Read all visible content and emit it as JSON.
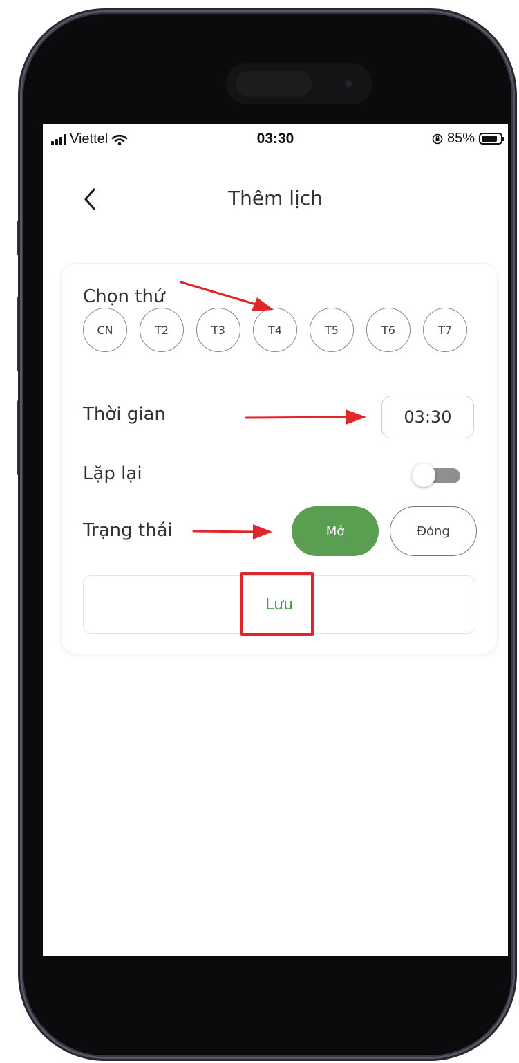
{
  "status_bar": {
    "carrier": "Viettel",
    "time": "03:30",
    "battery": "85%",
    "battery_level": 0.85
  },
  "nav": {
    "title": "Thêm lịch"
  },
  "form": {
    "day_label": "Chọn thứ",
    "days": [
      "CN",
      "T2",
      "T3",
      "T4",
      "T5",
      "T6",
      "T7"
    ],
    "time_label": "Thời gian",
    "time_value": "03:30",
    "repeat_label": "Lặp lại",
    "repeat_on": false,
    "status_label": "Trạng thái",
    "status_open": "Mở",
    "status_closed": "Đóng",
    "status_selected": "Mở",
    "save_label": "Lưu"
  },
  "colors": {
    "accent_green": "#5a9e52",
    "save_text_green": "#3fa33a",
    "annotation_red": "#e0262b"
  }
}
